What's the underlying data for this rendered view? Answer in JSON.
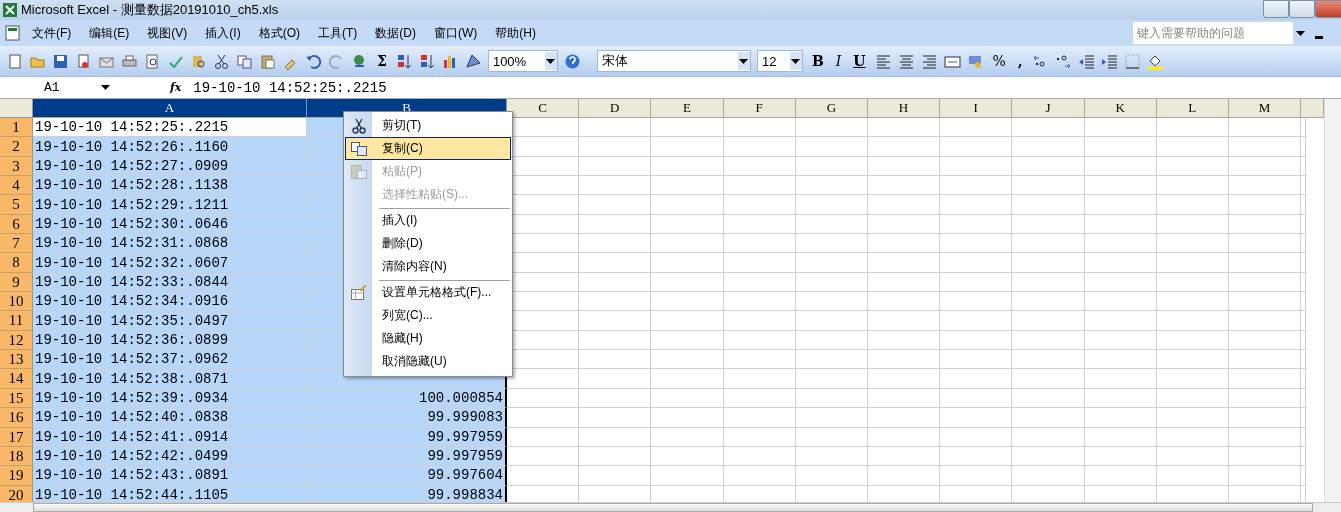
{
  "window": {
    "title": "Microsoft Excel - 测量数据20191010_ch5.xls"
  },
  "menu_bar": {
    "items": [
      "文件(F)",
      "编辑(E)",
      "视图(V)",
      "插入(I)",
      "格式(O)",
      "工具(T)",
      "数据(D)",
      "窗口(W)",
      "帮助(H)"
    ],
    "help_search": {
      "placeholder": "键入需要帮助的问题"
    }
  },
  "standard_toolbar": {
    "sum": "Σ",
    "zoom": "100%"
  },
  "formatting_toolbar": {
    "font": "宋体",
    "size": "12",
    "styles": [
      "B",
      "I",
      "U"
    ],
    "percent": "%",
    "comma": ","
  },
  "formula_bar": {
    "name_box": "A1",
    "fx": "fx",
    "value": "19-10-10 14:52:25:.2215"
  },
  "columns": [
    {
      "label": "A",
      "selected": true
    },
    {
      "label": "B",
      "selected": true
    },
    {
      "label": "C",
      "selected": false
    },
    {
      "label": "D",
      "selected": false
    },
    {
      "label": "E",
      "selected": false
    },
    {
      "label": "F",
      "selected": false
    },
    {
      "label": "G",
      "selected": false
    },
    {
      "label": "H",
      "selected": false
    },
    {
      "label": "I",
      "selected": false
    },
    {
      "label": "J",
      "selected": false
    },
    {
      "label": "K",
      "selected": false
    },
    {
      "label": "L",
      "selected": false
    },
    {
      "label": "M",
      "selected": false
    }
  ],
  "rows": [
    {
      "label": "1",
      "selected": true,
      "a": "19-10-10 14:52:25:.2215",
      "active": true
    },
    {
      "label": "2",
      "selected": true,
      "a": "19-10-10 14:52:26:.1160",
      "active": false
    },
    {
      "label": "3",
      "selected": true,
      "a": "19-10-10 14:52:27:.0909",
      "active": false
    },
    {
      "label": "4",
      "selected": true,
      "a": "19-10-10 14:52:28:.1138",
      "active": false
    },
    {
      "label": "5",
      "selected": true,
      "a": "19-10-10 14:52:29:.1211",
      "active": false
    },
    {
      "label": "6",
      "selected": true,
      "a": "19-10-10 14:52:30:.0646",
      "active": false
    },
    {
      "label": "7",
      "selected": true,
      "a": "19-10-10 14:52:31:.0868",
      "active": false
    },
    {
      "label": "8",
      "selected": true,
      "a": "19-10-10 14:52:32:.0607",
      "active": false
    },
    {
      "label": "9",
      "selected": true,
      "a": "19-10-10 14:52:33:.0844",
      "active": false
    },
    {
      "label": "10",
      "selected": true,
      "a": "19-10-10 14:52:34:.0916",
      "active": false
    },
    {
      "label": "11",
      "selected": true,
      "a": "19-10-10 14:52:35:.0497",
      "active": false
    },
    {
      "label": "12",
      "selected": true,
      "a": "19-10-10 14:52:36:.0899",
      "active": false
    },
    {
      "label": "13",
      "selected": true,
      "a": "19-10-10 14:52:37:.0962",
      "active": false
    },
    {
      "label": "14",
      "selected": true,
      "a": "19-10-10 14:52:38:.0871",
      "active": false
    },
    {
      "label": "15",
      "selected": true,
      "a": "19-10-10 14:52:39:.0934",
      "b": "100.000854",
      "active": false
    },
    {
      "label": "16",
      "selected": true,
      "a": "19-10-10 14:52:40:.0838",
      "b": "99.999083",
      "active": false
    },
    {
      "label": "17",
      "selected": true,
      "a": "19-10-10 14:52:41:.0914",
      "b": "99.997959",
      "active": false
    },
    {
      "label": "18",
      "selected": true,
      "a": "19-10-10 14:52:42:.0499",
      "b": "99.997959",
      "active": false
    },
    {
      "label": "19",
      "selected": true,
      "a": "19-10-10 14:52:43:.0891",
      "b": "99.997604",
      "active": false
    },
    {
      "label": "20",
      "selected": true,
      "a": "19-10-10 14:52:44:.1105",
      "b": "99.998834",
      "active": false
    }
  ],
  "context_menu": {
    "items": [
      {
        "label": "剪切(T)",
        "selected": false,
        "disabled": false,
        "separator_before": false
      },
      {
        "label": "复制(C)",
        "selected": true,
        "disabled": false,
        "separator_before": false
      },
      {
        "label": "粘贴(P)",
        "selected": false,
        "disabled": true,
        "separator_before": false
      },
      {
        "label": "选择性粘贴(S)...",
        "selected": false,
        "disabled": true,
        "separator_before": false
      },
      {
        "label": "插入(I)",
        "selected": false,
        "disabled": false,
        "separator_before": true
      },
      {
        "label": "删除(D)",
        "selected": false,
        "disabled": false,
        "separator_before": false
      },
      {
        "label": "清除内容(N)",
        "selected": false,
        "disabled": false,
        "separator_before": false
      },
      {
        "label": "设置单元格格式(F)...",
        "selected": false,
        "disabled": false,
        "separator_before": true
      },
      {
        "label": "列宽(C)...",
        "selected": false,
        "disabled": false,
        "separator_before": false
      },
      {
        "label": "隐藏(H)",
        "selected": false,
        "disabled": false,
        "separator_before": false
      },
      {
        "label": "取消隐藏(U)",
        "selected": false,
        "disabled": false,
        "separator_before": false
      }
    ]
  }
}
